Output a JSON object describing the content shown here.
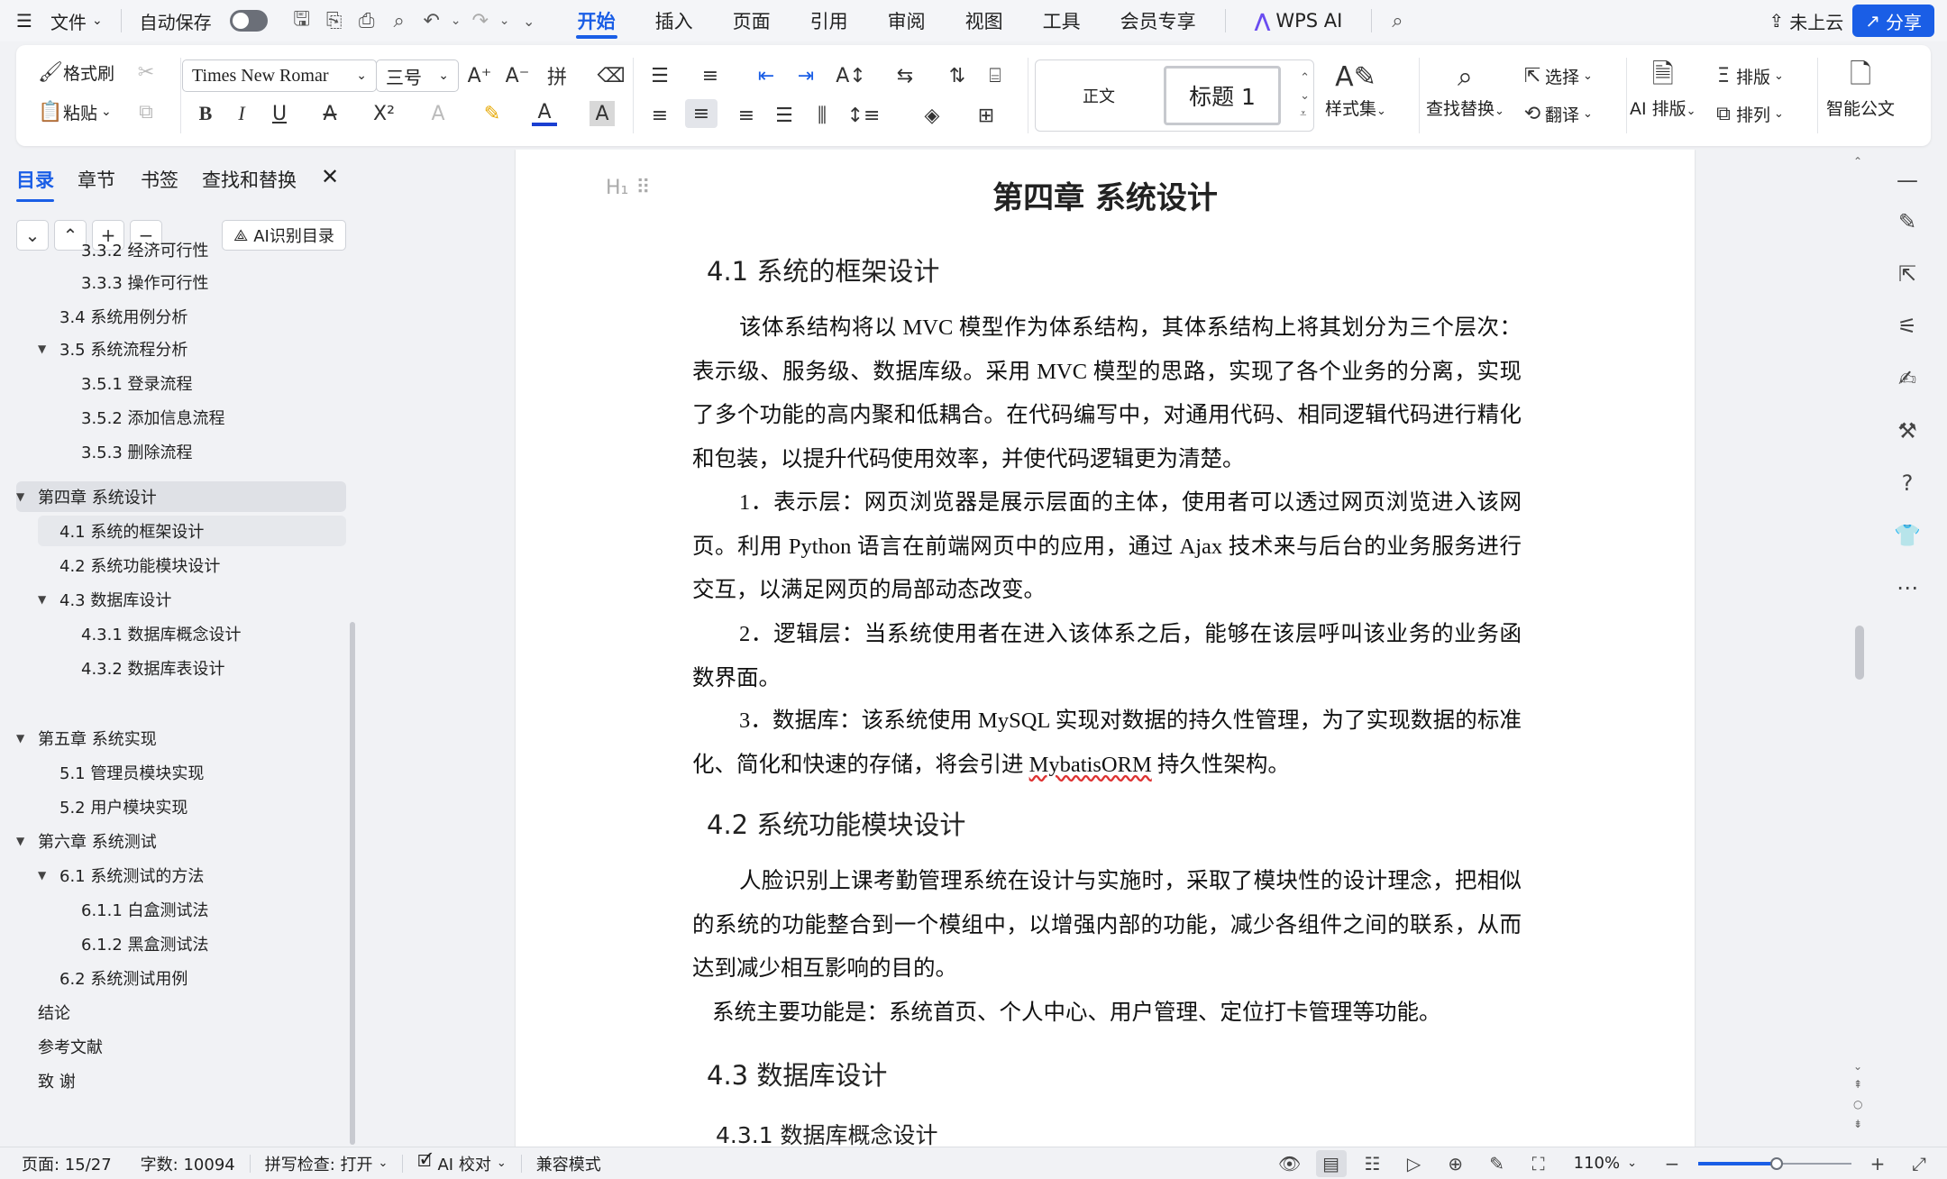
{
  "menubar": {
    "file": "文件",
    "autosave": "自动保存",
    "tabs": [
      "开始",
      "插入",
      "页面",
      "引用",
      "审阅",
      "视图",
      "工具",
      "会员专享"
    ],
    "active_tab": "开始",
    "wps_ai": "WPS AI",
    "cloud": "未上云",
    "share": "分享",
    "accent": "#1a5ee6"
  },
  "ribbon": {
    "format_painter": "格式刷",
    "paste": "粘贴",
    "font_name": "Times New Romar",
    "font_size": "三号",
    "style_normal": "正文",
    "style_heading": "标题 1",
    "style_set": "样式集",
    "find_replace": "查找替换",
    "select": "选择",
    "translate": "翻译",
    "ai_layout": "AI 排版",
    "typeset": "排版",
    "arrange": "排列",
    "smart_doc": "智能公文"
  },
  "panel": {
    "tabs": [
      "目录",
      "章节",
      "书签",
      "查找和替换"
    ],
    "ai_toc": "AI识别目录",
    "toc": [
      {
        "label": "3.3.2  经济可行性",
        "level": 3
      },
      {
        "label": "3.3.3  操作可行性",
        "level": 3
      },
      {
        "label": "3.4  系统用例分析",
        "level": 2
      },
      {
        "label": "3.5  系统流程分析",
        "level": 2,
        "expanded": true
      },
      {
        "label": "3.5.1  登录流程",
        "level": 3
      },
      {
        "label": "3.5.2  添加信息流程",
        "level": 3
      },
      {
        "label": "3.5.3  删除流程",
        "level": 3
      },
      {
        "label": "第四章  系统设计",
        "level": 1,
        "expanded": true
      },
      {
        "label": "4.1 系统的框架设计",
        "level": 2
      },
      {
        "label": "4.2 系统功能模块设计",
        "level": 2
      },
      {
        "label": "4.3  数据库设计",
        "level": 2,
        "expanded": true
      },
      {
        "label": "4.3.1 数据库概念设计",
        "level": 3
      },
      {
        "label": "4.3.2  数据库表设计",
        "level": 3
      },
      {
        "label": "第五章  系统实现",
        "level": 1,
        "expanded": true
      },
      {
        "label": "5.1 管理员模块实现",
        "level": 2
      },
      {
        "label": "5.2 用户模块实现",
        "level": 2
      },
      {
        "label": "第六章  系统测试",
        "level": 1,
        "expanded": true
      },
      {
        "label": "6.1 系统测试的方法",
        "level": 2,
        "expanded": true
      },
      {
        "label": "6.1.1 白盒测试法",
        "level": 3
      },
      {
        "label": "6.1.2 黑盒测试法",
        "level": 3
      },
      {
        "label": "6.2 系统测试用例",
        "level": 2
      },
      {
        "label": "结论",
        "level": 1
      },
      {
        "label": "参考文献",
        "level": 1
      },
      {
        "label": "致     谢",
        "level": 1
      }
    ]
  },
  "document": {
    "chapter_title": "第四章  系统设计",
    "s41": "4.1 系统的框架设计",
    "p1": "该体系结构将以 MVC 模型作为体系结构，其体系结构上将其划分为三个层次：表示级、服务级、数据库级。采用 MVC 模型的思路，实现了各个业务的分离，实现了多个功能的高内聚和低耦合。在代码编写中，对通用代码、相同逻辑代码进行精化和包装，以提升代码使用效率，并使代码逻辑更为清楚。",
    "p2": "1．表示层：网页浏览器是展示层面的主体，使用者可以透过网页浏览进入该网页。利用 Python 语言在前端网页中的应用，通过 Ajax 技术来与后台的业务服务进行交互，以满足网页的局部动态改变。",
    "p3": "2．逻辑层：当系统使用者在进入该体系之后，能够在该层呼叫该业务的业务函数界面。",
    "p4_a": "3．数据库：该系统使用 MySQL 实现对数据的持久性管理，为了实现数据的标准化、简化和快速的存储，将会引进 ",
    "p4_b": "MybatisORM",
    "p4_c": " 持久性架构。",
    "s42": "4.2 系统功能模块设计",
    "p5": "人脸识别上课考勤管理系统在设计与实施时，采取了模块性的设计理念，把相似的系统的功能整合到一个模组中，以增强内部的功能，减少各组件之间的联系，从而达到减少相互影响的目的。",
    "p6": "系统主要功能是：系统首页、个人中心、用户管理、定位打卡管理等功能。",
    "s43": "4.3  数据库设计",
    "s431": "4.3.1 数据库概念设计"
  },
  "statusbar": {
    "page": "页面: 15/27",
    "words": "字数: 10094",
    "spell": "拼写检查: 打开",
    "ai_check": "AI 校对",
    "compat": "兼容模式",
    "zoom": "110%",
    "zoom_level_percent": 110
  }
}
